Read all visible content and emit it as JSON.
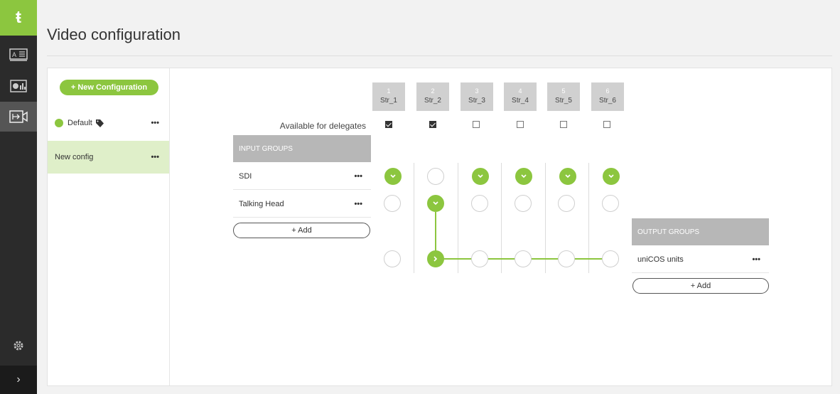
{
  "app": {
    "logo_glyph": "ŧ"
  },
  "sidebar": {
    "items": [
      {
        "name": "text-panel-icon"
      },
      {
        "name": "dashboard-icon"
      },
      {
        "name": "video-icon",
        "active": true
      },
      {
        "name": "gear-icon"
      }
    ],
    "expand_glyph": "›"
  },
  "header": {
    "title": "Video configuration"
  },
  "configs": {
    "new_button": "+ New Configuration",
    "items": [
      {
        "label": "Default",
        "more": "•••",
        "has_tag": true
      },
      {
        "label": "New config",
        "more": "•••",
        "selected": true
      }
    ]
  },
  "streams": [
    {
      "num": "1",
      "name": "Str_1",
      "delegates": true
    },
    {
      "num": "2",
      "name": "Str_2",
      "delegates": true
    },
    {
      "num": "3",
      "name": "Str_3",
      "delegates": false
    },
    {
      "num": "4",
      "name": "Str_4",
      "delegates": false
    },
    {
      "num": "5",
      "name": "Str_5",
      "delegates": false
    },
    {
      "num": "6",
      "name": "Str_6",
      "delegates": false
    }
  ],
  "available_label": "Available for delegates",
  "input_groups": {
    "header": "INPUT GROUPS",
    "items": [
      {
        "label": "SDI",
        "more": "•••"
      },
      {
        "label": "Talking Head",
        "more": "•••"
      }
    ],
    "add": "+ Add"
  },
  "output_groups": {
    "header": "OUTPUT GROUPS",
    "items": [
      {
        "label": "uniCOS units",
        "more": "•••"
      }
    ],
    "add": "+ Add"
  },
  "matrix": {
    "input_selection": [
      [
        true,
        false,
        true,
        true,
        true,
        true
      ],
      [
        false,
        true,
        false,
        false,
        false,
        false
      ]
    ],
    "output_selection": [
      false,
      true,
      false,
      false,
      false,
      false
    ]
  },
  "colors": {
    "accent": "#8cc63f",
    "sidebar": "#2b2b2b",
    "selected_row": "#dfefc9",
    "group_header": "#b7b7b7"
  }
}
